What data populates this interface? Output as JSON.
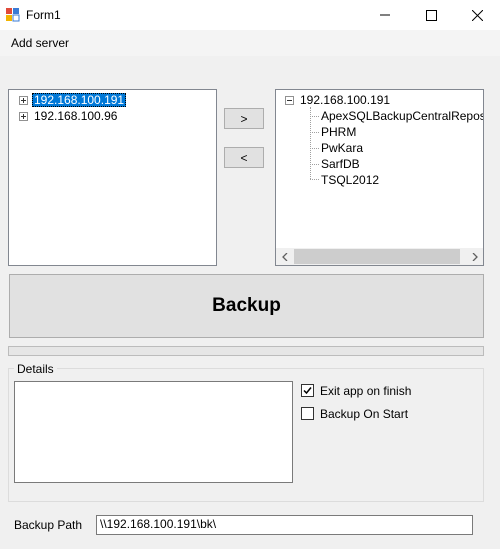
{
  "window": {
    "title": "Form1"
  },
  "menu": {
    "items": [
      {
        "label": "Add server"
      }
    ]
  },
  "left_tree": {
    "nodes": [
      {
        "label": "192.168.100.191",
        "selected": true
      },
      {
        "label": "192.168.100.96",
        "selected": false
      }
    ]
  },
  "move_buttons": {
    "right_label": ">",
    "left_label": "<"
  },
  "right_tree": {
    "root": "192.168.100.191",
    "children": [
      "ApexSQLBackupCentralRepository",
      "PHRM",
      "PwKara",
      "SarfDB",
      "TSQL2012"
    ]
  },
  "backup_button": {
    "label": "Backup"
  },
  "details": {
    "group_label": "Details",
    "text": "",
    "exit_on_finish": {
      "label": "Exit app on finish",
      "checked": true
    },
    "backup_on_start": {
      "label": "Backup On Start",
      "checked": false
    }
  },
  "backup_path": {
    "label": "Backup Path",
    "value": "\\\\192.168.100.191\\bk\\"
  },
  "colors": {
    "selection": "#0078d7",
    "window_bg": "#f0f0f0"
  }
}
